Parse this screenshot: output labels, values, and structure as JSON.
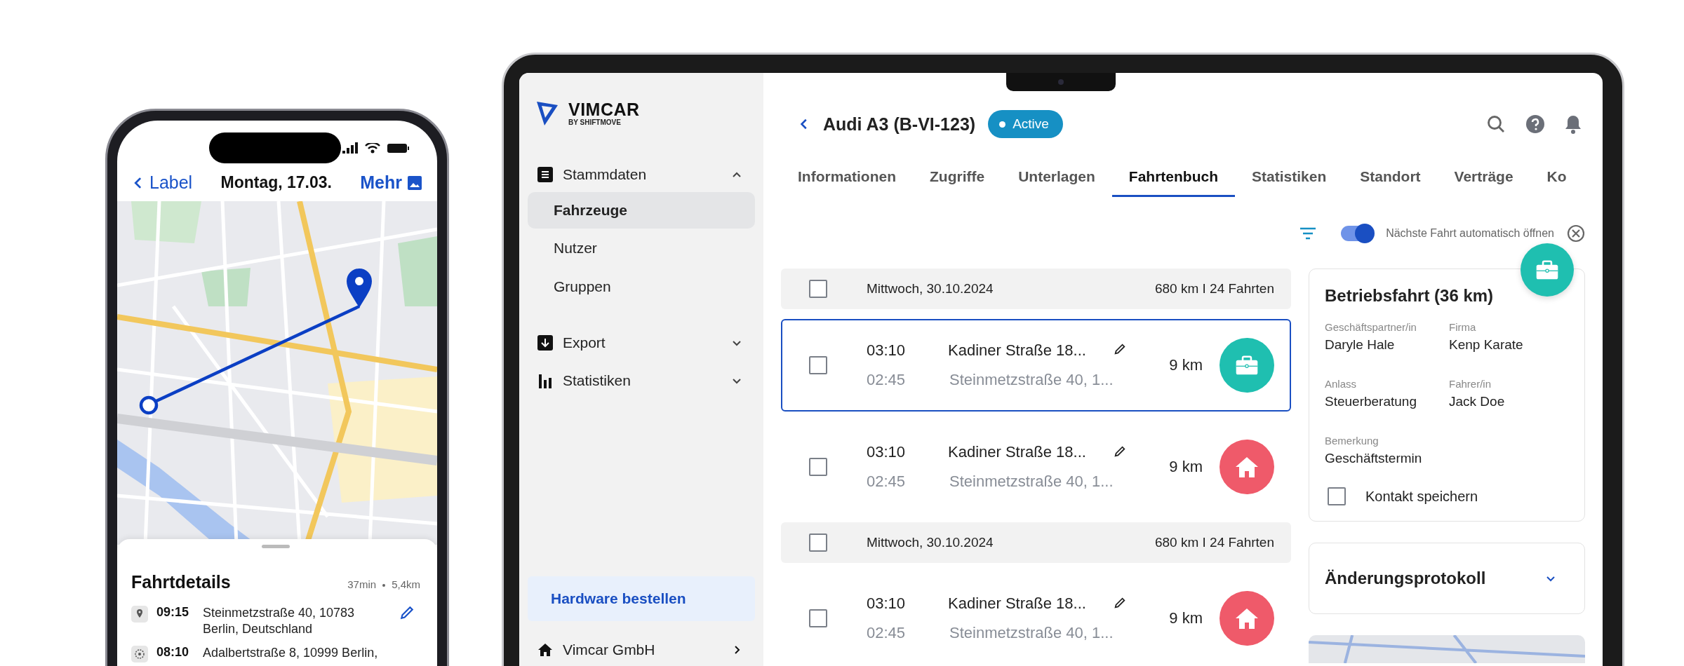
{
  "phone": {
    "nav": {
      "back": "Label",
      "title": "Montag, 17.03.",
      "more": "Mehr"
    },
    "sheet": {
      "title": "Fahrtdetails",
      "duration": "37min",
      "distance": "5,4km",
      "stops": [
        {
          "kind": "start",
          "time": "09:15",
          "address": "Steinmetzstraße 40, 10783 Berlin, Deutschland",
          "editable": true
        },
        {
          "kind": "end",
          "time": "08:10",
          "address": "Adalbertstraße 8, 10999 Berlin,",
          "editable": false
        }
      ]
    }
  },
  "laptop": {
    "logo": {
      "name": "VIMCAR",
      "tagline": "BY SHIFTMOVE"
    },
    "sidebar": {
      "items": [
        {
          "label": "Stammdaten",
          "expanded": true,
          "children": [
            {
              "label": "Fahrzeuge",
              "selected": true
            },
            {
              "label": "Nutzer",
              "selected": false
            },
            {
              "label": "Gruppen",
              "selected": false
            }
          ]
        },
        {
          "label": "Export",
          "expanded": false
        },
        {
          "label": "Statistiken",
          "expanded": false
        }
      ],
      "cta": "Hardware bestellen",
      "account": "Vimcar GmbH"
    },
    "header": {
      "title": "Audi A3 (B-VI-123)",
      "status": "Active"
    },
    "tabs": [
      {
        "label": "Informationen",
        "selected": false
      },
      {
        "label": "Zugriffe",
        "selected": false
      },
      {
        "label": "Unterlagen",
        "selected": false
      },
      {
        "label": "Fahrtenbuch",
        "selected": true
      },
      {
        "label": "Statistiken",
        "selected": false
      },
      {
        "label": "Standort",
        "selected": false
      },
      {
        "label": "Verträge",
        "selected": false
      },
      {
        "label": "Ko",
        "selected": false
      }
    ],
    "toolbar": {
      "auto_open": {
        "label": "Nächste Fahrt automatisch öffnen",
        "on": true
      }
    },
    "list": [
      {
        "kind": "day",
        "date": "Mittwoch, 30.10.2024",
        "summary": "680 km I 24 Fahrten",
        "checked": false
      },
      {
        "kind": "business",
        "start_time": "03:10",
        "end_time": "02:45",
        "from": "Kadiner Straße 18...",
        "to": "Steinmetzstraße 40, 1...",
        "distance": "9 km",
        "selected": true,
        "checked": false
      },
      {
        "kind": "private",
        "start_time": "03:10",
        "end_time": "02:45",
        "from": "Kadiner Straße 18...",
        "to": "Steinmetzstraße 40, 1...",
        "distance": "9 km",
        "selected": false,
        "checked": false
      },
      {
        "kind": "day",
        "date": "Mittwoch, 30.10.2024",
        "summary": "680 km I 24 Fahrten",
        "checked": false
      },
      {
        "kind": "private",
        "start_time": "03:10",
        "end_time": "02:45",
        "from": "Kadiner Straße 18...",
        "to": "Steinmetzstraße 40, 1...",
        "distance": "9 km",
        "selected": false,
        "checked": false
      }
    ],
    "detail": {
      "kind": "business",
      "title": "Betriebsfahrt (36 km)",
      "fields": [
        {
          "label": "Geschäftspartner/in",
          "value": "Daryle Hale"
        },
        {
          "label": "Firma",
          "value": "Kenp Karate"
        },
        {
          "label": "Anlass",
          "value": "Steuerberatung"
        },
        {
          "label": "Fahrer/in",
          "value": "Jack Doe"
        },
        {
          "label": "Bemerkung",
          "value": "Geschäftstermin"
        }
      ],
      "save_contact": {
        "label": "Kontakt speichern",
        "checked": false
      }
    },
    "changelog": {
      "title": "Änderungsprotokoll",
      "expanded": false
    }
  }
}
